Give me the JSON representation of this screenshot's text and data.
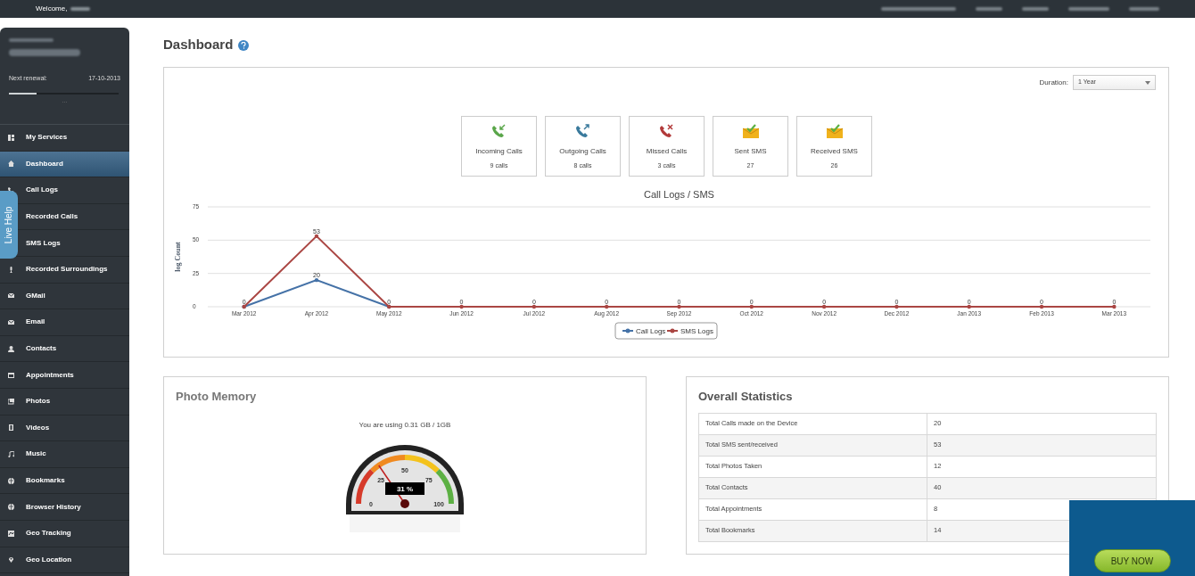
{
  "top_bar": {
    "welcome": "Welcome,"
  },
  "sidebar": {
    "renewal_label": "Next renewal:",
    "renewal_date": "17-10-2013",
    "renewal_progress": {
      "level": 0.25
    },
    "more": "...",
    "items": [
      {
        "label": "My Services",
        "selected": false
      },
      {
        "label": "Dashboard",
        "selected": true
      },
      {
        "label": "Call Logs",
        "selected": false
      },
      {
        "label": "Recorded Calls",
        "selected": false
      },
      {
        "label": "SMS Logs",
        "selected": false
      },
      {
        "label": "Recorded Surroundings",
        "selected": false
      },
      {
        "label": "GMail",
        "selected": false
      },
      {
        "label": "Email",
        "selected": false
      },
      {
        "label": "Contacts",
        "selected": false
      },
      {
        "label": "Appointments",
        "selected": false
      },
      {
        "label": "Photos",
        "selected": false
      },
      {
        "label": "Videos",
        "selected": false
      },
      {
        "label": "Music",
        "selected": false
      },
      {
        "label": "Bookmarks",
        "selected": false
      },
      {
        "label": "Browser History",
        "selected": false
      },
      {
        "label": "Geo Tracking",
        "selected": false
      },
      {
        "label": "Geo Location",
        "selected": false
      }
    ]
  },
  "live_help": "Live Help",
  "page_title": "Dashboard",
  "duration": {
    "label": "Duration:",
    "value": "1 Year"
  },
  "stat_cards": [
    {
      "kind": "incoming",
      "label": "Incoming Calls",
      "value": "9 calls"
    },
    {
      "kind": "outgoing",
      "label": "Outgoing Calls",
      "value": "8 calls"
    },
    {
      "kind": "missed",
      "label": "Missed Calls",
      "value": "3 calls"
    },
    {
      "kind": "sms",
      "label": "Sent SMS",
      "value": "27"
    },
    {
      "kind": "sms",
      "label": "Received SMS",
      "value": "26"
    }
  ],
  "chart": {
    "chart_data": {
      "type": "line",
      "title": "Call Logs / SMS",
      "ylabel": "log Count",
      "categories": [
        "Mar 2012",
        "Apr 2012",
        "May 2012",
        "Jun 2012",
        "Jul 2012",
        "Aug 2012",
        "Sep 2012",
        "Oct 2012",
        "Nov 2012",
        "Dec 2012",
        "Jan 2013",
        "Feb 2013",
        "Mar 2013"
      ],
      "ylim": [
        0,
        75
      ],
      "yticks": [
        {
          "value": 0,
          "label": "0"
        },
        {
          "value": 25,
          "label": "25"
        },
        {
          "value": 50,
          "label": "50"
        },
        {
          "value": 75,
          "label": "75"
        }
      ],
      "legend": "bottom",
      "series": [
        {
          "name": "Call Logs",
          "color": "#4572a7",
          "values": [
            0,
            20,
            0,
            null,
            null,
            null,
            null,
            null,
            null,
            null,
            null,
            null,
            null
          ],
          "value_labels": [
            null,
            "20",
            null,
            null,
            null,
            null,
            null,
            null,
            null,
            null,
            null,
            null,
            null
          ]
        },
        {
          "name": "SMS Logs",
          "color": "#aa4643",
          "values": [
            0,
            53,
            0,
            0,
            0,
            0,
            0,
            0,
            0,
            0,
            0,
            0,
            0
          ],
          "value_labels": [
            "0",
            "53",
            "0",
            "0",
            "0",
            "0",
            "0",
            "0",
            "0",
            "0",
            "0",
            "0",
            "0"
          ]
        }
      ]
    }
  },
  "photo_memory": {
    "title": "Photo Memory",
    "usage": "You are using 0.31 GB / 1GB",
    "gauge": {
      "level": 0.31,
      "reading": "31 %",
      "ticks": [
        "0",
        "25",
        "50",
        "75",
        "100"
      ]
    }
  },
  "overall_statistics": {
    "title": "Overall Statistics",
    "rows": [
      [
        "Total Calls made on the Device",
        "20"
      ],
      [
        "Total SMS sent/received",
        "53"
      ],
      [
        "Total Photos Taken",
        "12"
      ],
      [
        "Total Contacts",
        "40"
      ],
      [
        "Total Appointments",
        "8"
      ],
      [
        "Total Bookmarks",
        "14"
      ]
    ]
  },
  "promo": {
    "button": "BUY NOW"
  }
}
